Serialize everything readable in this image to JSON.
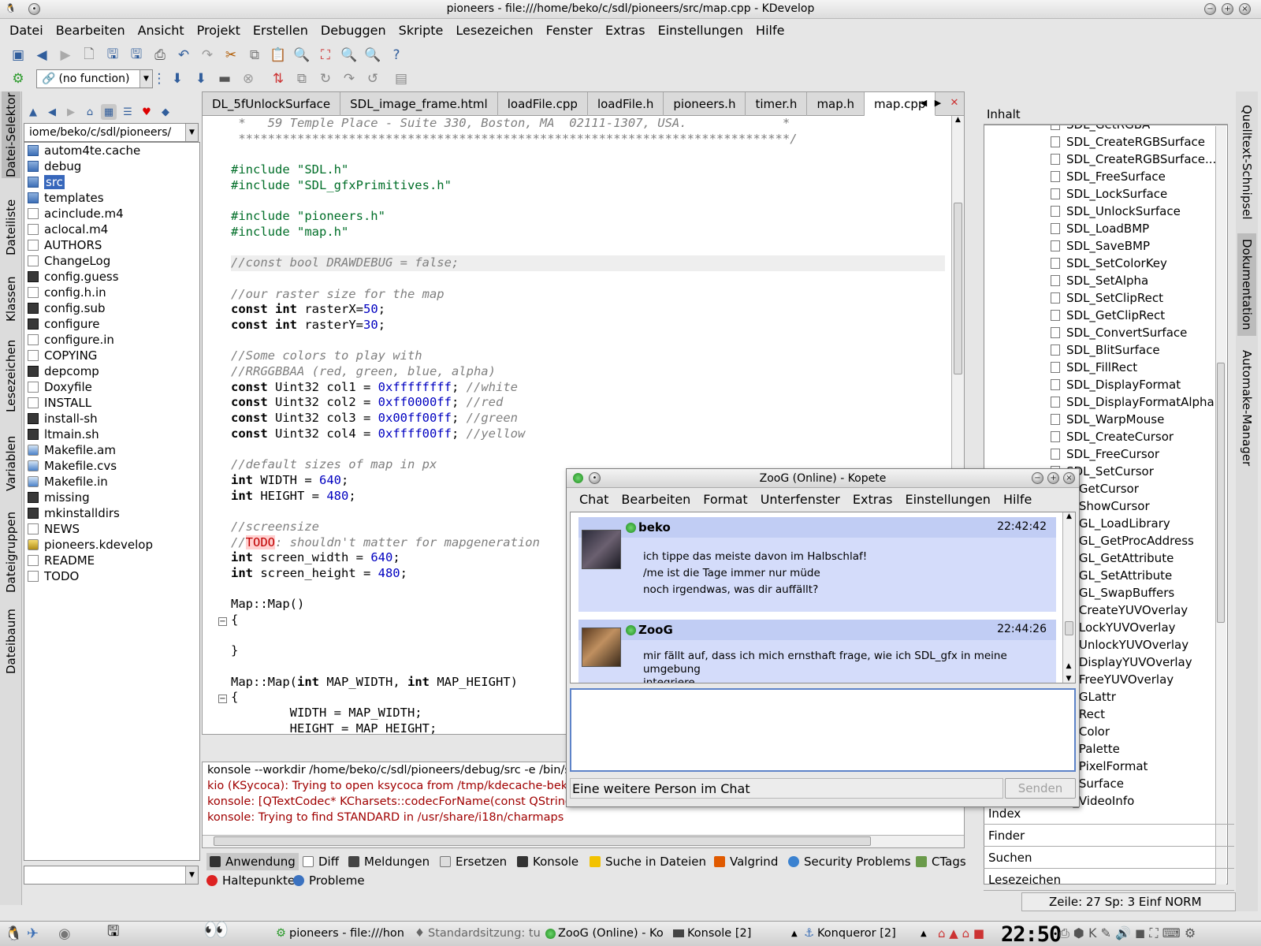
{
  "window": {
    "title": "pioneers - file:///home/beko/c/sdl/pioneers/src/map.cpp - KDevelop"
  },
  "menu": [
    "Datei",
    "Bearbeiten",
    "Ansicht",
    "Projekt",
    "Erstellen",
    "Debuggen",
    "Skripte",
    "Lesezeichen",
    "Fenster",
    "Extras",
    "Einstellungen",
    "Hilfe"
  ],
  "toolbar": {
    "function_combo": "(no function)"
  },
  "left_tabs": [
    "Datei-Selektor",
    "Dateiliste",
    "Klassen",
    "Lesezeichen",
    "Variablen",
    "Dateigruppen",
    "Dateibaum"
  ],
  "file_selector": {
    "path": "iome/beko/c/sdl/pioneers/",
    "files": [
      {
        "name": "autom4te.cache",
        "type": "dir"
      },
      {
        "name": "debug",
        "type": "dir"
      },
      {
        "name": "src",
        "type": "dir",
        "selected": true
      },
      {
        "name": "templates",
        "type": "dir"
      },
      {
        "name": "acinclude.m4",
        "type": "file"
      },
      {
        "name": "aclocal.m4",
        "type": "file"
      },
      {
        "name": "AUTHORS",
        "type": "file"
      },
      {
        "name": "ChangeLog",
        "type": "file"
      },
      {
        "name": "config.guess",
        "type": "exec"
      },
      {
        "name": "config.h.in",
        "type": "file"
      },
      {
        "name": "config.sub",
        "type": "exec"
      },
      {
        "name": "configure",
        "type": "exec"
      },
      {
        "name": "configure.in",
        "type": "file"
      },
      {
        "name": "COPYING",
        "type": "file"
      },
      {
        "name": "depcomp",
        "type": "exec"
      },
      {
        "name": "Doxyfile",
        "type": "file"
      },
      {
        "name": "INSTALL",
        "type": "file"
      },
      {
        "name": "install-sh",
        "type": "exec"
      },
      {
        "name": "ltmain.sh",
        "type": "exec"
      },
      {
        "name": "Makefile.am",
        "type": "special"
      },
      {
        "name": "Makefile.cvs",
        "type": "special"
      },
      {
        "name": "Makefile.in",
        "type": "special"
      },
      {
        "name": "missing",
        "type": "exec"
      },
      {
        "name": "mkinstalldirs",
        "type": "exec"
      },
      {
        "name": "NEWS",
        "type": "file"
      },
      {
        "name": "pioneers.kdevelop",
        "type": "proj"
      },
      {
        "name": "README",
        "type": "file"
      },
      {
        "name": "TODO",
        "type": "file"
      }
    ]
  },
  "editor": {
    "tabs": [
      "DL_5fUnlockSurface",
      "SDL_image_frame.html",
      "loadFile.cpp",
      "loadFile.h",
      "pioneers.h",
      "timer.h",
      "map.h",
      "map.cpp"
    ],
    "active_tab": "map.cpp",
    "lines": [
      " *   59 Temple Place - Suite 330, Boston, MA  02111-1307, USA.             *",
      " ***************************************************************************/",
      "",
      "#include \"SDL.h\"",
      "#include \"SDL_gfxPrimitives.h\"",
      "",
      "#include \"pioneers.h\"",
      "#include \"map.h\"",
      "",
      "//const bool DRAWDEBUG = false;",
      "",
      "//our raster size for the map",
      "const int rasterX=50;",
      "const int rasterY=30;",
      "",
      "//Some colors to play with",
      "//RRGGBBAA (red, green, blue, alpha)",
      "const Uint32 col1 = 0xffffffff; //white",
      "const Uint32 col2 = 0xff0000ff; //red",
      "const Uint32 col3 = 0x00ff00ff; //green",
      "const Uint32 col4 = 0xffff00ff; //yellow",
      "",
      "//default sizes of map in px",
      "int WIDTH = 640;",
      "int HEIGHT = 480;",
      "",
      "//screensize",
      "//TODO: shouldn't matter for mapgeneration",
      "int screen_width = 640;",
      "int screen_height = 480;",
      "",
      "Map::Map()",
      "{",
      "",
      "}",
      "",
      "Map::Map(int MAP_WIDTH, int MAP_HEIGHT)",
      "{",
      "        WIDTH = MAP_WIDTH;",
      "        HEIGHT = MAP_HEIGHT;"
    ]
  },
  "output": {
    "lines": [
      "konsole --workdir /home/beko/c/sdl/pioneers/debug/src -e /bin/sh",
      "kio (KSycoca): Trying to open ksycoca from /tmp/kdecache-beko",
      "konsole: [QTextCodec* KCharsets::codecForName(const QString&, bool&) const]",
      "konsole:  Trying to find STANDARD in /usr/share/i18n/charmaps"
    ]
  },
  "bottom_tabs": [
    "Anwendung",
    "Diff",
    "Meldungen",
    "Ersetzen",
    "Konsole",
    "Suche in Dateien",
    "Valgrind",
    "Security Problems",
    "CTags",
    "Haltepunkte",
    "Probleme"
  ],
  "docs": {
    "header": "Inhalt",
    "items": [
      "SDL_GetRGBA",
      "SDL_CreateRGBSurface",
      "SDL_CreateRGBSurface...",
      "SDL_FreeSurface",
      "SDL_LockSurface",
      "SDL_UnlockSurface",
      "SDL_LoadBMP",
      "SDL_SaveBMP",
      "SDL_SetColorKey",
      "SDL_SetAlpha",
      "SDL_SetClipRect",
      "SDL_GetClipRect",
      "SDL_ConvertSurface",
      "SDL_BlitSurface",
      "SDL_FillRect",
      "SDL_DisplayFormat",
      "SDL_DisplayFormatAlpha",
      "SDL_WarpMouse",
      "SDL_CreateCursor",
      "SDL_FreeCursor",
      "SDL_SetCursor",
      "L_GetCursor",
      "L_ShowCursor",
      "L_GL_LoadLibrary",
      "L_GL_GetProcAddress",
      "L_GL_GetAttribute",
      "L_GL_SetAttribute",
      "L_GL_SwapBuffers",
      "L_CreateYUVOverlay",
      "L_LockYUVOverlay",
      "L_UnlockYUVOverlay",
      "L_DisplayYUVOverlay",
      "L_FreeYUVOverlay",
      "L_GLattr",
      "L_Rect",
      "L_Color",
      "L_Palette",
      "L_PixelFormat",
      "L_Surface",
      "L_VideoInfo"
    ],
    "tabs": [
      "Index",
      "Finder",
      "Suchen",
      "Lesezeichen"
    ]
  },
  "right_tabs": [
    "Quelltext-Schnipsel",
    "Dokumentation",
    "Automake-Manager"
  ],
  "status": {
    "text": "Zeile: 27 Sp: 3  Einf  NORM"
  },
  "chat": {
    "title": "ZooG (Online) - Kopete",
    "menu": [
      "Chat",
      "Bearbeiten",
      "Format",
      "Unterfenster",
      "Extras",
      "Einstellungen",
      "Hilfe"
    ],
    "messages": [
      {
        "nick": "beko",
        "time": "22:42:42",
        "lines": [
          "ich tippe das meiste davon im Halbschlaf!",
          "/me ist die Tage immer nur müde",
          "noch irgendwas, was dir auffällt?"
        ]
      },
      {
        "nick": "ZooG",
        "time": "22:44:26",
        "lines": [
          "mir fällt auf, dass ich mich ernsthaft frage, wie ich SDL_gfx in meine umgebung",
          "integriere"
        ]
      }
    ],
    "status_text": "Eine weitere Person im Chat",
    "send_label": "Senden"
  },
  "taskbar": {
    "tasks": [
      "pioneers - file:///hon",
      "Standardsitzung: tu",
      "ZooG (Online) - Ko",
      "Konsole [2]",
      "Konqueror [2]"
    ],
    "clock": "22:50"
  }
}
